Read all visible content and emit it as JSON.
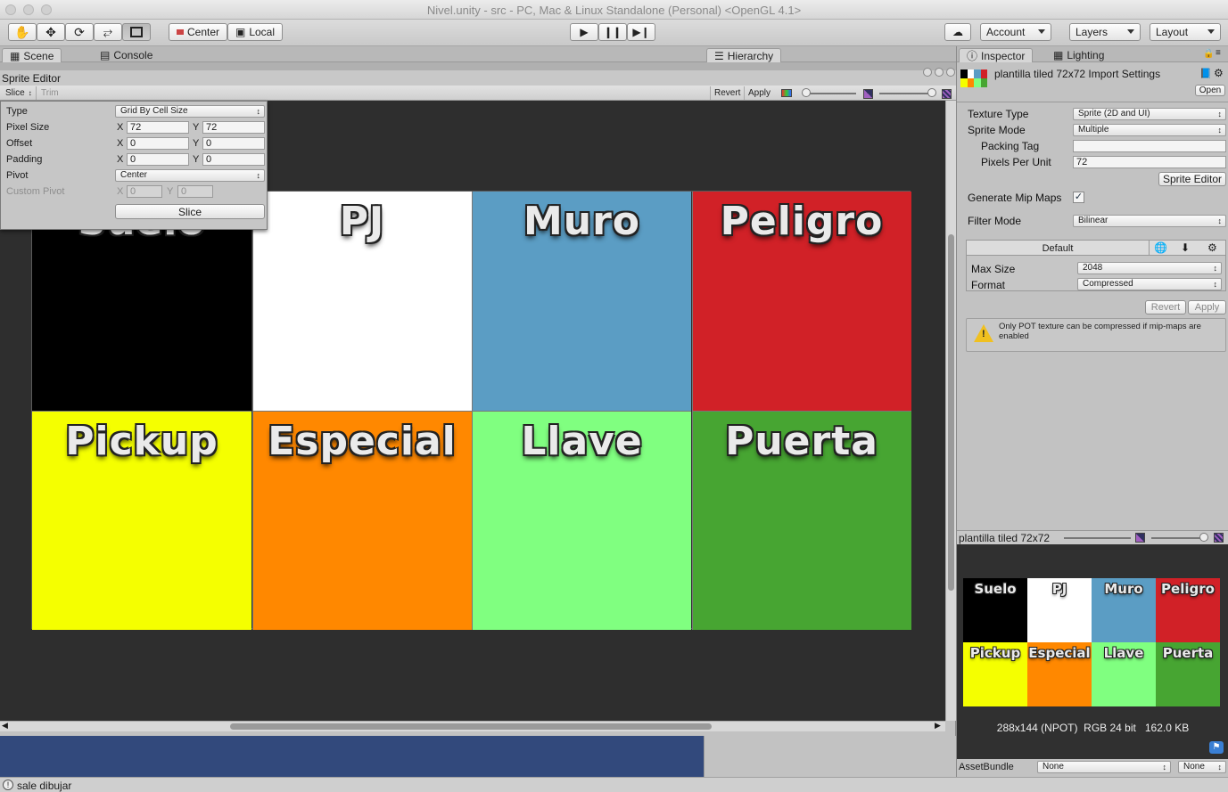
{
  "window": {
    "title": "Nivel.unity - src - PC, Mac & Linux Standalone (Personal) <OpenGL 4.1>"
  },
  "toolbar": {
    "tools": [
      "hand-tool",
      "move-tool",
      "rotate-tool",
      "scale-tool",
      "rect-tool"
    ],
    "pivot_center": "Center",
    "pivot_local": "Local",
    "account": "Account",
    "layers": "Layers",
    "layout": "Layout"
  },
  "tabs": {
    "scene": "Scene",
    "console": "Console",
    "hierarchy": "Hierarchy",
    "inspector": "Inspector",
    "lighting": "Lighting"
  },
  "sprite_editor": {
    "title": "Sprite Editor",
    "slice": "Slice",
    "trim": "Trim",
    "revert": "Revert",
    "apply": "Apply",
    "tiles": [
      {
        "label": "Suelo",
        "color": "#000000"
      },
      {
        "label": "PJ",
        "color": "#ffffff"
      },
      {
        "label": "Muro",
        "color": "#5b9dc4"
      },
      {
        "label": "Peligro",
        "color": "#d12127"
      },
      {
        "label": "Pickup",
        "color": "#f5ff00"
      },
      {
        "label": "Especial",
        "color": "#ff8800"
      },
      {
        "label": "Llave",
        "color": "#80ff80"
      },
      {
        "label": "Puerta",
        "color": "#47a532"
      }
    ]
  },
  "slice_popup": {
    "type_label": "Type",
    "type_value": "Grid By Cell Size",
    "pixel_size_label": "Pixel Size",
    "pixel_x": "72",
    "pixel_y": "72",
    "offset_label": "Offset",
    "offset_x": "0",
    "offset_y": "0",
    "padding_label": "Padding",
    "padding_x": "0",
    "padding_y": "0",
    "pivot_label": "Pivot",
    "pivot_value": "Center",
    "custom_pivot_label": "Custom Pivot",
    "custom_x": "0",
    "custom_y": "0",
    "x": "X",
    "y": "Y",
    "slice_button": "Slice"
  },
  "inspector": {
    "asset_title": "plantilla tiled 72x72 Import Settings",
    "open": "Open",
    "texture_type_label": "Texture Type",
    "texture_type": "Sprite (2D and UI)",
    "sprite_mode_label": "Sprite Mode",
    "sprite_mode": "Multiple",
    "packing_tag_label": "Packing Tag",
    "packing_tag": "",
    "ppu_label": "Pixels Per Unit",
    "ppu": "72",
    "sprite_editor_btn": "Sprite Editor",
    "mipmaps_label": "Generate Mip Maps",
    "filter_label": "Filter Mode",
    "filter": "Bilinear",
    "platform_default": "Default",
    "max_size_label": "Max Size",
    "max_size": "2048",
    "format_label": "Format",
    "format": "Compressed",
    "revert": "Revert",
    "apply": "Apply",
    "warning": "Only POT texture can be compressed if mip-maps are enabled",
    "preview_name": "plantilla tiled 72x72",
    "preview_info": "288x144 (NPOT)  RGB 24 bit   162.0 KB",
    "assetbundle_label": "AssetBundle",
    "assetbundle_value": "None",
    "assetbundle_variant": "None"
  },
  "status": {
    "message": "sale dibujar"
  }
}
